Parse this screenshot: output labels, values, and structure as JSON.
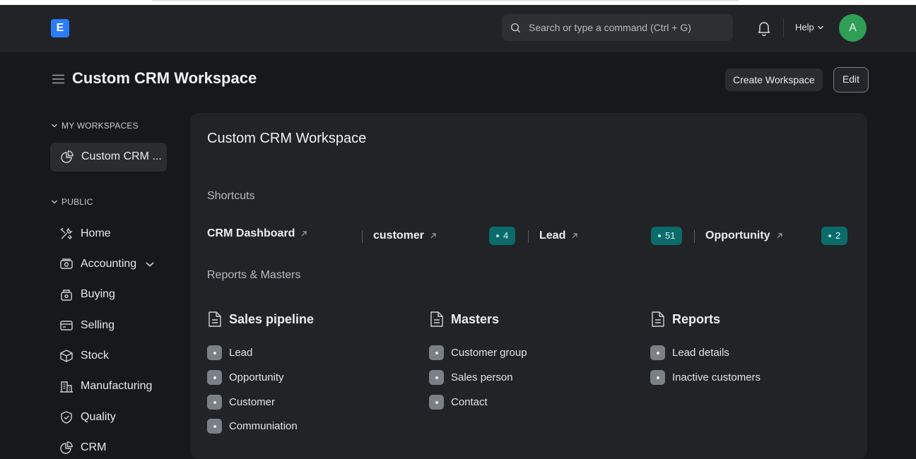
{
  "navbar": {
    "logo_letter": "E",
    "search_placeholder": "Search or type a command (Ctrl + G)",
    "help_label": "Help",
    "avatar_initial": "A"
  },
  "header": {
    "title": "Custom CRM Workspace",
    "create_workspace_label": "Create Workspace",
    "edit_label": "Edit"
  },
  "sidebar": {
    "my_workspaces_label": "MY WORKSPACES",
    "my_workspaces": [
      {
        "label": "Custom CRM ...",
        "icon": "pie-chart-icon"
      }
    ],
    "public_label": "PUBLIC",
    "public_items": [
      {
        "label": "Home",
        "icon": "tools-icon"
      },
      {
        "label": "Accounting",
        "icon": "money-icon"
      },
      {
        "label": "Buying",
        "icon": "basket-icon"
      },
      {
        "label": "Selling",
        "icon": "card-icon"
      },
      {
        "label": "Stock",
        "icon": "box-icon"
      },
      {
        "label": "Manufacturing",
        "icon": "building-icon"
      },
      {
        "label": "Quality",
        "icon": "shield-icon"
      },
      {
        "label": "CRM",
        "icon": "pie-chart-icon"
      }
    ]
  },
  "main": {
    "title": "Custom CRM Workspace",
    "shortcuts_heading": "Shortcuts",
    "shortcuts": [
      {
        "label": "CRM Dashboard",
        "count": ""
      },
      {
        "label": "customer",
        "count": "4"
      },
      {
        "label": "Lead",
        "count": "51"
      },
      {
        "label": "Opportunity",
        "count": "2"
      }
    ],
    "reports_heading": "Reports & Masters",
    "groups": [
      {
        "title": "Sales pipeline",
        "links": [
          "Lead",
          "Opportunity",
          "Customer",
          "Communiation"
        ]
      },
      {
        "title": "Masters",
        "links": [
          "Customer group",
          "Sales person",
          "Contact"
        ]
      },
      {
        "title": "Reports",
        "links": [
          "Lead details",
          "Inactive customers"
        ]
      }
    ]
  },
  "colors": {
    "background": "#17181a",
    "panel": "#212327",
    "badge": "#0b6b6b",
    "avatar": "#2f9e57",
    "logo": "#2b7cf7"
  }
}
